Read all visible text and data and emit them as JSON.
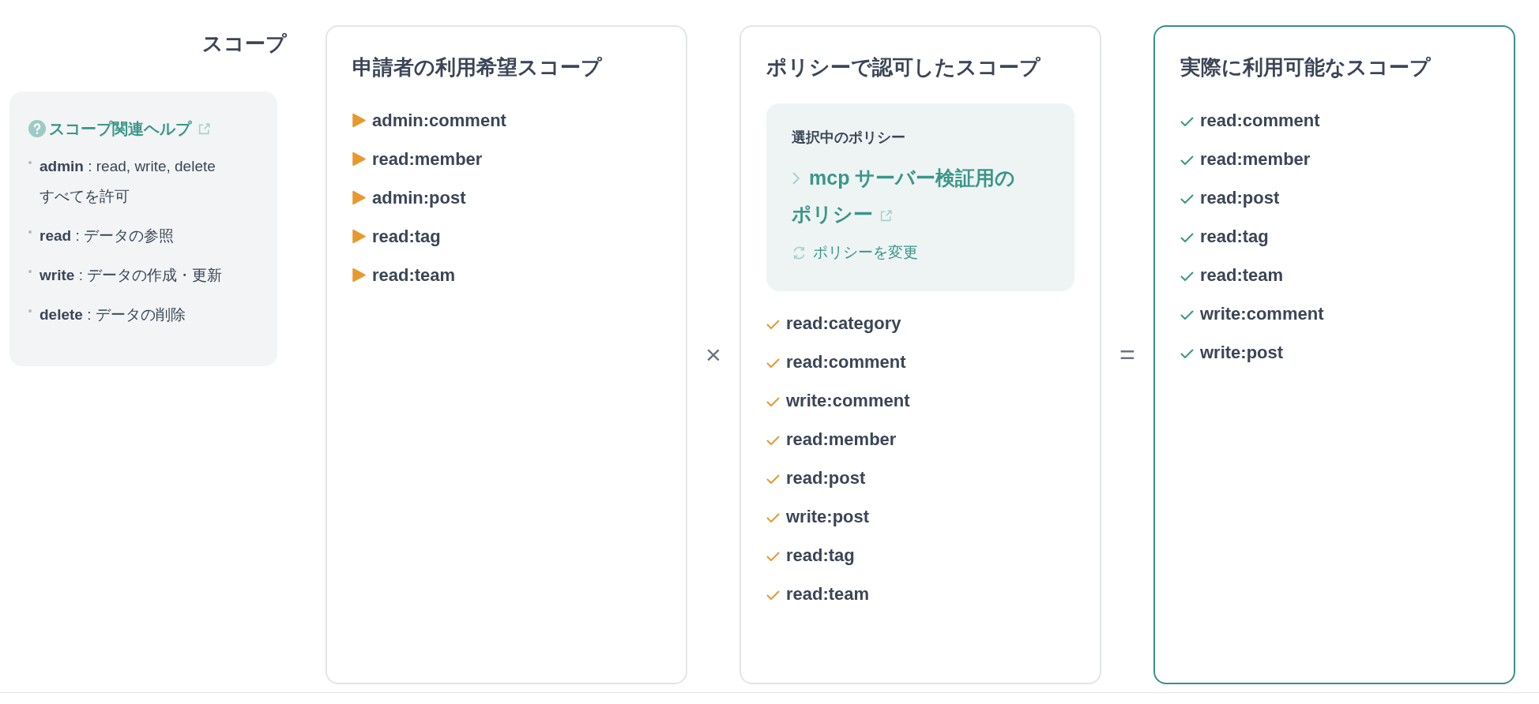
{
  "section_title": "スコープ",
  "help": {
    "title": "スコープ関連ヘルプ",
    "items": [
      "**admin** : read, write, delete すべてを許可",
      "**read** : データの参照",
      "**write** : データの作成・更新",
      "**delete** : データの削除"
    ]
  },
  "panels": [
    {
      "title": "申請者の利用希望スコープ",
      "kind": "triangle",
      "highlighted": false,
      "items": [
        "admin:comment",
        "read:member",
        "admin:post",
        "read:tag",
        "read:team"
      ]
    },
    {
      "title": "ポリシーで認可したスコープ",
      "kind": "check_orange",
      "highlighted": false,
      "policy": {
        "label": "選択中のポリシー",
        "name": "mcp サーバー検証用のポリシー",
        "change_button": "ポリシーを変更"
      },
      "items": [
        "read:category",
        "read:comment",
        "write:comment",
        "read:member",
        "read:post",
        "write:post",
        "read:tag",
        "read:team"
      ]
    },
    {
      "title": "実際に利用可能なスコープ",
      "kind": "check_teal",
      "highlighted": true,
      "items": [
        "read:comment",
        "read:member",
        "read:post",
        "read:tag",
        "read:team",
        "write:comment",
        "write:post"
      ]
    }
  ],
  "operators": [
    "×",
    "="
  ]
}
